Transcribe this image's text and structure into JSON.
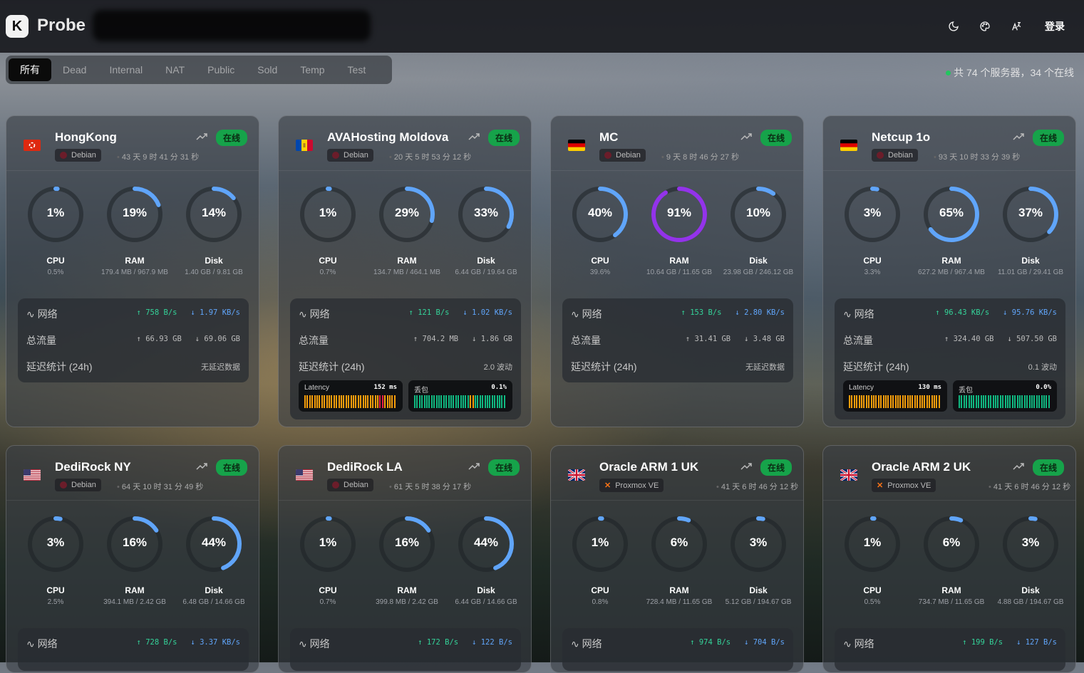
{
  "header": {
    "logo_letter": "K",
    "brand": "Probe",
    "login": "登录",
    "icons": [
      "moon-icon",
      "palette-icon",
      "translate-icon"
    ]
  },
  "filters": {
    "items": [
      "所有",
      "Dead",
      "Internal",
      "NAT",
      "Public",
      "Sold",
      "Temp",
      "Test"
    ],
    "active": 0
  },
  "summary": "共 74 个服务器，34 个在线",
  "labels": {
    "network": "网络",
    "traffic": "总流量",
    "latency": "延迟统计 (24h)",
    "no_latency": "无延迟数据",
    "jitter_suffix": "波动",
    "latency_box": "Latency",
    "loss_box": "丢包",
    "cpu": "CPU",
    "ram": "RAM",
    "disk": "Disk",
    "online": "在线"
  },
  "servers": [
    {
      "name": "HongKong",
      "flag": "hk",
      "os": "Debian",
      "uptime": "43 天 9 时 41 分 31 秒",
      "cpu": 1,
      "ram": 19,
      "disk": 14,
      "cpu_sub": "0.5%",
      "ram_sub": "179.4 MB / 967.9 MB",
      "disk_sub": "1.40 GB / 9.81 GB",
      "net_up": "↑ 758 B/s",
      "net_down": "↓ 1.97 KB/s",
      "tot_up": "↑ 66.93 GB",
      "tot_down": "↓ 69.06 GB",
      "latency_text": "无延迟数据",
      "has_bars": false
    },
    {
      "name": "AVAHosting Moldova",
      "flag": "md",
      "os": "Debian",
      "uptime": "20 天 5 时 53 分 12 秒",
      "cpu": 1,
      "ram": 29,
      "disk": 33,
      "cpu_sub": "0.7%",
      "ram_sub": "134.7 MB / 464.1 MB",
      "disk_sub": "6.44 GB / 19.64 GB",
      "net_up": "↑ 121 B/s",
      "net_down": "↓ 1.02 KB/s",
      "tot_up": "↑ 704.2 MB",
      "tot_down": "↓ 1.86 GB",
      "latency_text": "2.0 波动",
      "has_bars": true,
      "lat_val": "152 ms",
      "loss_val": "0.1%"
    },
    {
      "name": "MC",
      "flag": "de",
      "os": "Debian",
      "uptime": "9 天 8 时 46 分 27 秒",
      "cpu": 40,
      "ram": 91,
      "disk": 10,
      "cpu_sub": "39.6%",
      "ram_sub": "10.64 GB / 11.65 GB",
      "disk_sub": "23.98 GB / 246.12 GB",
      "net_up": "↑ 153 B/s",
      "net_down": "↓ 2.80 KB/s",
      "tot_up": "↑ 31.41 GB",
      "tot_down": "↓ 3.48 GB",
      "latency_text": "无延迟数据",
      "has_bars": false
    },
    {
      "name": "Netcup 1o",
      "flag": "de",
      "os": "Debian",
      "uptime": "93 天 10 时 33 分 39 秒",
      "cpu": 3,
      "ram": 65,
      "disk": 37,
      "cpu_sub": "3.3%",
      "ram_sub": "627.2 MB / 967.4 MB",
      "disk_sub": "11.01 GB / 29.41 GB",
      "net_up": "↑ 96.43 KB/s",
      "net_down": "↓ 95.76 KB/s",
      "tot_up": "↑ 324.40 GB",
      "tot_down": "↓ 507.50 GB",
      "latency_text": "0.1 波动",
      "has_bars": true,
      "lat_val": "130 ms",
      "loss_val": "0.0%"
    },
    {
      "name": "DediRock NY",
      "flag": "us",
      "os": "Debian",
      "uptime": "64 天 10 时 31 分 49 秒",
      "cpu": 3,
      "ram": 16,
      "disk": 44,
      "cpu_sub": "2.5%",
      "ram_sub": "394.1 MB / 2.42 GB",
      "disk_sub": "6.48 GB / 14.66 GB",
      "net_up": "↑ 728 B/s",
      "net_down": "↓ 3.37 KB/s"
    },
    {
      "name": "DediRock LA",
      "flag": "us",
      "os": "Debian",
      "uptime": "61 天 5 时 38 分 17 秒",
      "cpu": 1,
      "ram": 16,
      "disk": 44,
      "cpu_sub": "0.7%",
      "ram_sub": "399.8 MB / 2.42 GB",
      "disk_sub": "6.44 GB / 14.66 GB",
      "net_up": "↑ 172 B/s",
      "net_down": "↓ 122 B/s"
    },
    {
      "name": "Oracle ARM 1 UK",
      "flag": "gb",
      "os": "Proxmox VE",
      "uptime": "41 天 6 时 46 分 12 秒",
      "cpu": 1,
      "ram": 6,
      "disk": 3,
      "cpu_sub": "0.8%",
      "ram_sub": "728.4 MB / 11.65 GB",
      "disk_sub": "5.12 GB / 194.67 GB",
      "net_up": "↑ 974 B/s",
      "net_down": "↓ 704 B/s"
    },
    {
      "name": "Oracle ARM 2 UK",
      "flag": "gb",
      "os": "Proxmox VE",
      "uptime": "41 天 6 时 46 分 12 秒",
      "cpu": 1,
      "ram": 6,
      "disk": 3,
      "cpu_sub": "0.5%",
      "ram_sub": "734.7 MB / 11.65 GB",
      "disk_sub": "4.88 GB / 194.67 GB",
      "net_up": "↑ 199 B/s",
      "net_down": "↓ 127 B/s"
    }
  ],
  "colors": {
    "accent_blue": "#60a5fa",
    "purple": "#9333ea",
    "online": "#16a34a",
    "latency_bar": "#f59e0b",
    "loss_bar": "#10b981"
  }
}
